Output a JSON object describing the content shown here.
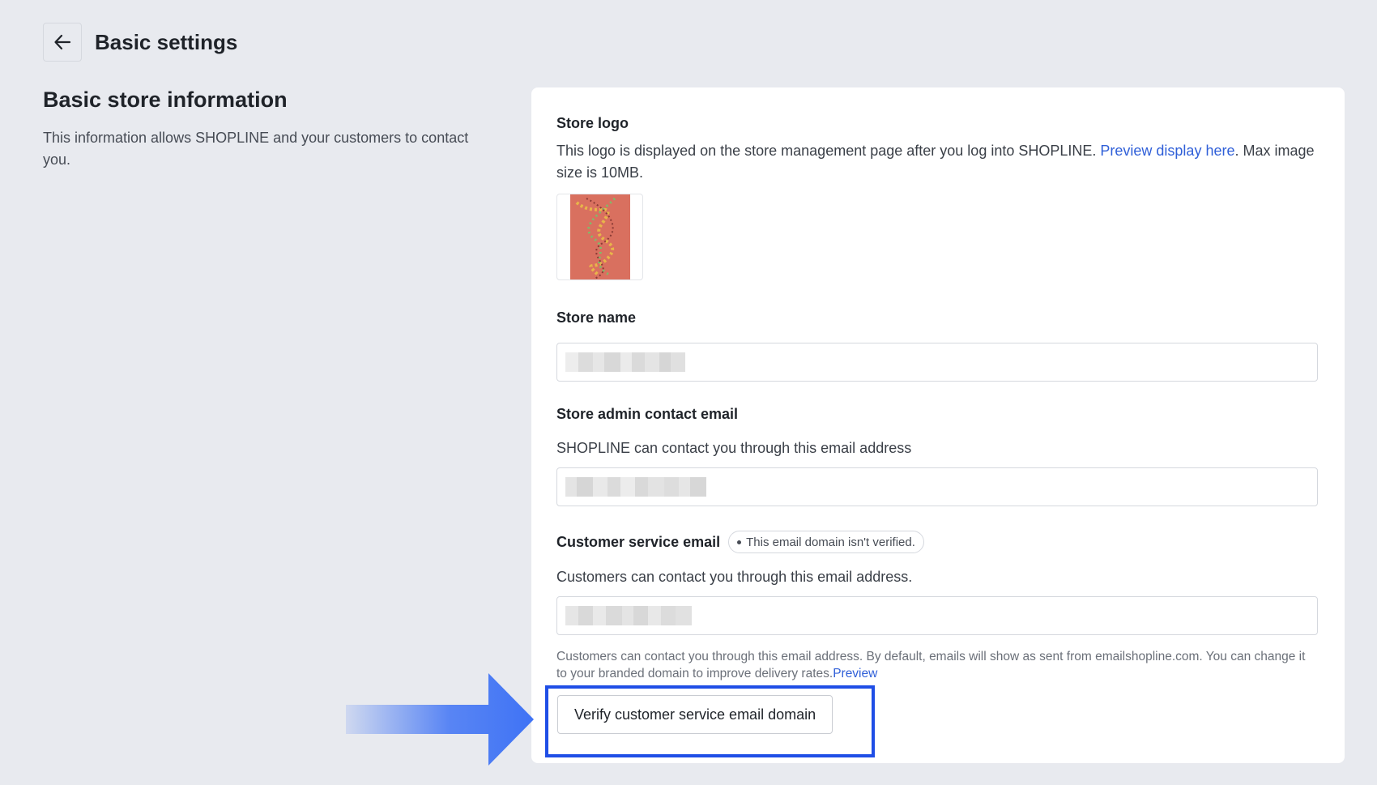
{
  "header": {
    "title": "Basic settings",
    "back_icon": "arrow-left-icon"
  },
  "left": {
    "section_title": "Basic store information",
    "section_description": "This information allows SHOPLINE and your customers to contact you."
  },
  "store_logo": {
    "label": "Store logo",
    "help_prefix": "This logo is displayed on the store management page after you log into SHOPLINE. ",
    "help_link": "Preview display here",
    "help_suffix": ". Max image size is 10MB."
  },
  "store_name": {
    "label": "Store name"
  },
  "admin_email": {
    "label": "Store admin contact email",
    "help": "SHOPLINE can contact you through this email address"
  },
  "customer_email": {
    "label": "Customer service email",
    "badge": "This email domain isn't verified.",
    "help": "Customers can contact you through this email address.",
    "note": "Customers can contact you through this email address. By default, emails will show as sent from emailshopline.com. You can change it to your branded domain to improve delivery rates.",
    "note_link": "Preview",
    "verify_button": "Verify customer service email domain"
  },
  "colors": {
    "background": "#e8eaef",
    "card": "#ffffff",
    "link": "#2f5fd8",
    "highlight": "#1f4ee6",
    "arrow": "#3f73f5",
    "logo_bg": "#d9705f"
  }
}
